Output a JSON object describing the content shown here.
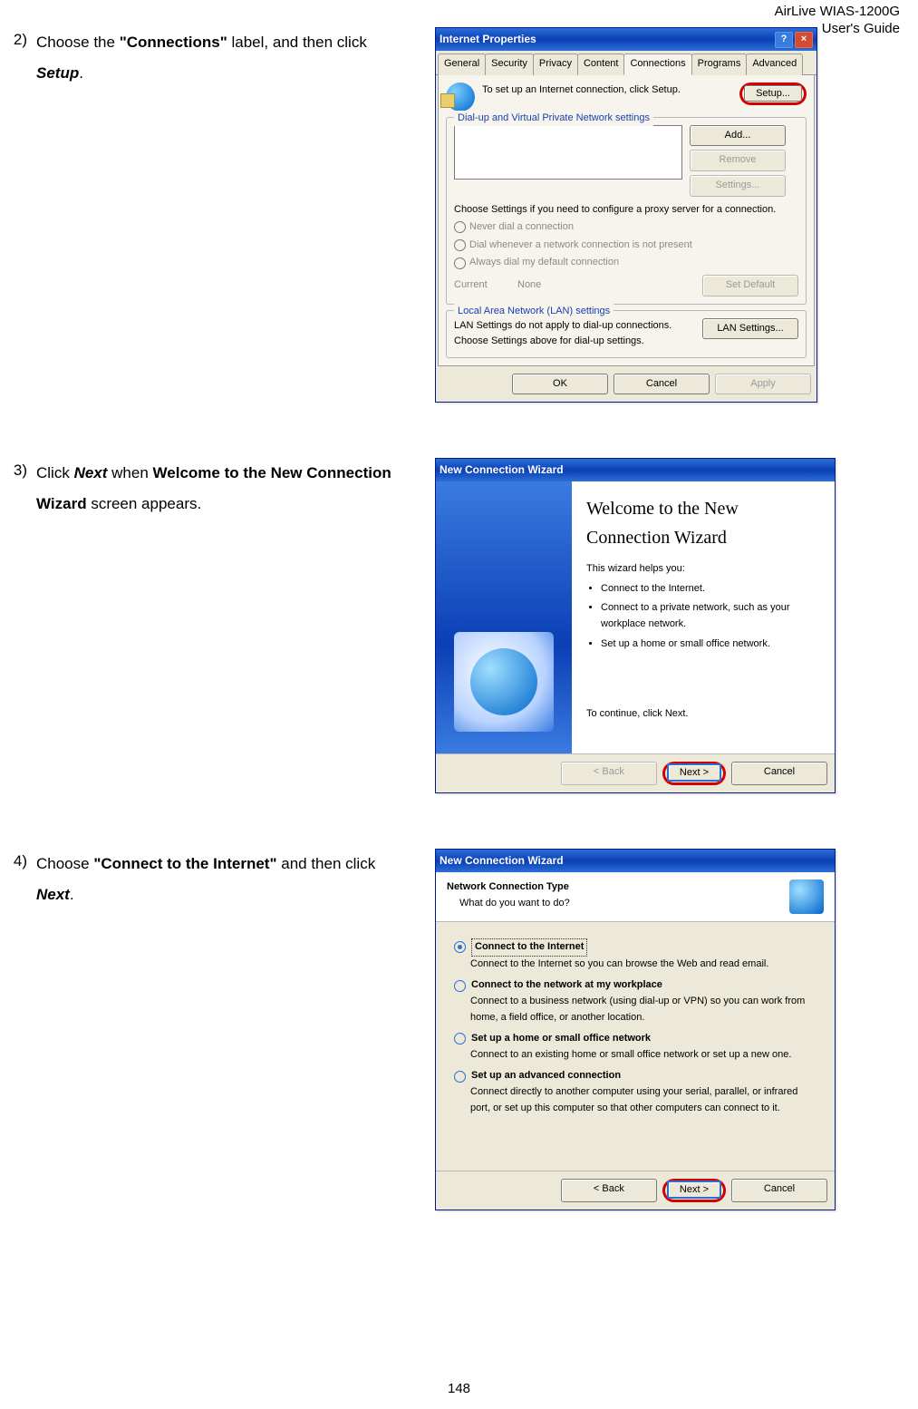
{
  "header": {
    "line1": "AirLive WIAS-1200G",
    "line2": "User's Guide"
  },
  "step2": {
    "num": "2)",
    "t1": "Choose the ",
    "b1": "\"Connections\"",
    "t2": " label, and then click ",
    "b2": "Setup",
    "t3": "."
  },
  "ip": {
    "title": "Internet Properties",
    "tabs": [
      "General",
      "Security",
      "Privacy",
      "Content",
      "Connections",
      "Programs",
      "Advanced"
    ],
    "setup_msg": "To set up an Internet connection, click Setup.",
    "setup_btn": "Setup...",
    "grp1": "Dial-up and Virtual Private Network settings",
    "add": "Add...",
    "remove": "Remove",
    "settings": "Settings...",
    "proxy_msg": "Choose Settings if you need to configure a proxy server for a connection.",
    "r1": "Never dial a connection",
    "r2": "Dial whenever a network connection is not present",
    "r3": "Always dial my default connection",
    "cur": "Current",
    "none": "None",
    "setdef": "Set Default",
    "grp2": "Local Area Network (LAN) settings",
    "lanmsg": "LAN Settings do not apply to dial-up connections. Choose Settings above for dial-up settings.",
    "lanbtn": "LAN Settings...",
    "ok": "OK",
    "cancel": "Cancel",
    "apply": "Apply"
  },
  "step3": {
    "num": "3)",
    "t1": "Click ",
    "b1": "Next",
    "t2": " when ",
    "b2": "Welcome to the New Connection Wizard",
    "t3": " screen appears."
  },
  "wiz1": {
    "title": "New Connection Wizard",
    "h": "Welcome to the New Connection Wizard",
    "help": "This wizard helps you:",
    "li1": "Connect to the Internet.",
    "li2": "Connect to a private network, such as your workplace network.",
    "li3": "Set up a home or small office network.",
    "cont": "To continue, click Next.",
    "back": "< Back",
    "next": "Next >",
    "cancel": "Cancel"
  },
  "step4": {
    "num": "4)",
    "t1": "Choose ",
    "b1": "\"Connect to the Internet\"",
    "t2": " and then click ",
    "b2": "Next",
    "t3": "."
  },
  "wiz2": {
    "title": "New Connection Wizard",
    "h": "Network Connection Type",
    "sub": "What do you want to do?",
    "o1": "Connect to the Internet",
    "o1d": "Connect to the Internet so you can browse the Web and read email.",
    "o2": "Connect to the network at my workplace",
    "o2d": "Connect to a business network (using dial-up or VPN) so you can work from home, a field office, or another location.",
    "o3": "Set up a home or small office network",
    "o3d": "Connect to an existing home or small office network or set up a new one.",
    "o4": "Set up an advanced connection",
    "o4d": "Connect directly to another computer using your serial, parallel, or infrared port, or set up this computer so that other computers can connect to it.",
    "back": "< Back",
    "next": "Next >",
    "cancel": "Cancel"
  },
  "pagefoot": "148"
}
